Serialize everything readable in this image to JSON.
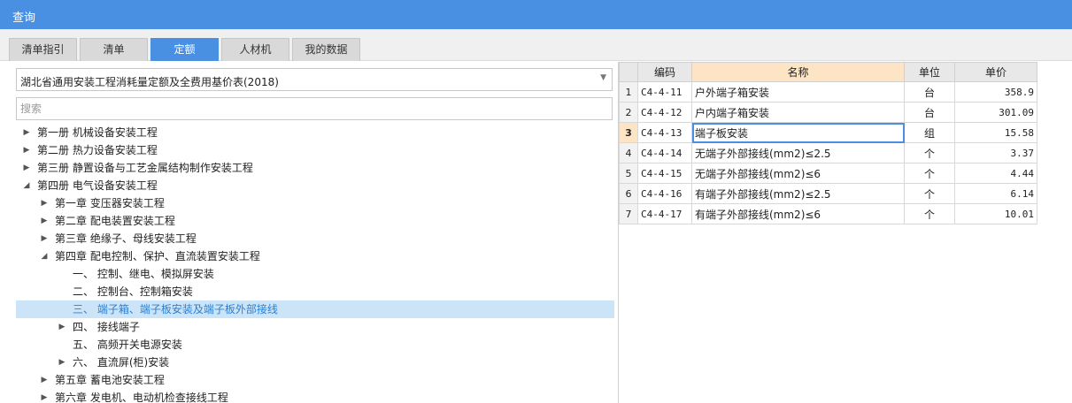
{
  "window": {
    "title": "查询"
  },
  "tabs": [
    {
      "label": "清单指引"
    },
    {
      "label": "清单"
    },
    {
      "label": "定额"
    },
    {
      "label": "人材机"
    },
    {
      "label": "我的数据"
    }
  ],
  "active_tab": "定额",
  "library_select": {
    "value": "湖北省通用安装工程消耗量定额及全费用基价表(2018)"
  },
  "search": {
    "placeholder": "搜索",
    "value": ""
  },
  "tree": [
    {
      "label": "第一册 机械设备安装工程",
      "level": 0,
      "toggle": "collapsed"
    },
    {
      "label": "第二册 热力设备安装工程",
      "level": 0,
      "toggle": "collapsed"
    },
    {
      "label": "第三册 静置设备与工艺金属结构制作安装工程",
      "level": 0,
      "toggle": "collapsed"
    },
    {
      "label": "第四册 电气设备安装工程",
      "level": 0,
      "toggle": "expanded"
    },
    {
      "label": "第一章 变压器安装工程",
      "level": 1,
      "toggle": "collapsed"
    },
    {
      "label": "第二章 配电装置安装工程",
      "level": 1,
      "toggle": "collapsed"
    },
    {
      "label": "第三章 绝缘子、母线安装工程",
      "level": 1,
      "toggle": "collapsed"
    },
    {
      "label": "第四章 配电控制、保护、直流装置安装工程",
      "level": 1,
      "toggle": "expanded"
    },
    {
      "label": "一、 控制、继电、模拟屏安装",
      "level": 2,
      "toggle": "none"
    },
    {
      "label": "二、 控制台、控制箱安装",
      "level": 2,
      "toggle": "none"
    },
    {
      "label": "三、 端子箱、端子板安装及端子板外部接线",
      "level": 2,
      "toggle": "none",
      "selected": true
    },
    {
      "label": "四、 接线端子",
      "level": 2,
      "toggle": "collapsed"
    },
    {
      "label": "五、 高频开关电源安装",
      "level": 2,
      "toggle": "none"
    },
    {
      "label": "六、 直流屏(柜)安装",
      "level": 2,
      "toggle": "collapsed"
    },
    {
      "label": "第五章 蓄电池安装工程",
      "level": 1,
      "toggle": "collapsed"
    },
    {
      "label": "第六章 发电机、电动机检查接线工程",
      "level": 1,
      "toggle": "collapsed"
    }
  ],
  "table": {
    "headers": {
      "code": "编码",
      "name": "名称",
      "unit": "单位",
      "price": "单价"
    },
    "rows": [
      {
        "n": "1",
        "code": "C4-4-11",
        "name": "户外端子箱安装",
        "unit": "台",
        "price": "358.9"
      },
      {
        "n": "2",
        "code": "C4-4-12",
        "name": "户内端子箱安装",
        "unit": "台",
        "price": "301.09"
      },
      {
        "n": "3",
        "code": "C4-4-13",
        "name": "端子板安装",
        "unit": "组",
        "price": "15.58",
        "current": true
      },
      {
        "n": "4",
        "code": "C4-4-14",
        "name": "无端子外部接线(mm2)≤2.5",
        "unit": "个",
        "price": "3.37"
      },
      {
        "n": "5",
        "code": "C4-4-15",
        "name": "无端子外部接线(mm2)≤6",
        "unit": "个",
        "price": "4.44"
      },
      {
        "n": "6",
        "code": "C4-4-16",
        "name": "有端子外部接线(mm2)≤2.5",
        "unit": "个",
        "price": "6.14"
      },
      {
        "n": "7",
        "code": "C4-4-17",
        "name": "有端子外部接线(mm2)≤6",
        "unit": "个",
        "price": "10.01"
      }
    ]
  },
  "colors": {
    "accent": "#4a90e2",
    "header_highlight": "#fce4c4",
    "tree_selected_bg": "#cce4f7",
    "tree_selected_text": "#2a7fd4"
  },
  "icons": {
    "collapsed": "triangle-right-icon",
    "expanded": "triangle-down-icon",
    "dropdown": "chevron-down-icon"
  }
}
